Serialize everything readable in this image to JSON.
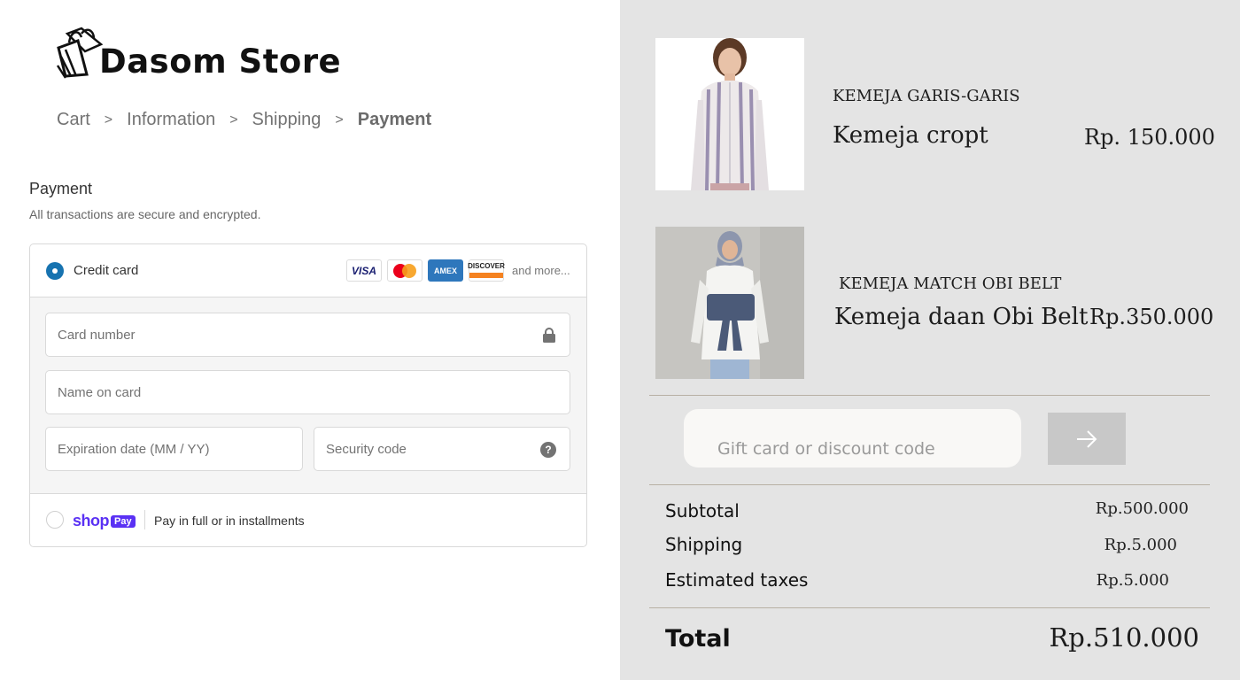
{
  "brand": {
    "name": "Dasom Store",
    "icon": "shopping-bags-icon"
  },
  "breadcrumb": [
    {
      "label": "Cart"
    },
    {
      "label": "Information"
    },
    {
      "label": "Shipping"
    },
    {
      "label": "Payment",
      "current": true
    }
  ],
  "breadcrumb_separator": ">",
  "payment": {
    "title": "Payment",
    "subtitle": "All transactions are secure and encrypted.",
    "credit_card": {
      "label": "Credit card",
      "selected": true,
      "brands": [
        "VISA",
        "Mastercard",
        "AMEX",
        "DISCOVER"
      ],
      "more": "and more...",
      "fields": {
        "card_number": "Card number",
        "name_on_card": "Name on card",
        "expiration": "Expiration date (MM / YY)",
        "security_code": "Security code"
      },
      "lock_icon": "lock-icon",
      "help_icon": "question-circle-icon",
      "help_glyph": "?"
    },
    "shop_pay": {
      "logo_word": "shop",
      "logo_badge": "Pay",
      "label": "Pay in full or in installments",
      "selected": false
    }
  },
  "colors": {
    "accent": "#1773b0",
    "shop_pay": "#5a31f4",
    "summary_bg": "#e4e4e4"
  },
  "products": [
    {
      "category": "KEMEJA GARIS-GARIS",
      "name": "Kemeja cropt",
      "price": "Rp. 150.000",
      "image": "striped-shirt-photo"
    },
    {
      "category": "KEMEJA MATCH OBI BELT",
      "name": "Kemeja daan Obi Belt",
      "price": "Rp.350.000",
      "image": "white-shirt-obi-belt-photo"
    }
  ],
  "discount": {
    "placeholder": "Gift card or discount code",
    "apply_icon": "arrow-right-icon"
  },
  "summary": {
    "subtotal_label": "Subtotal",
    "subtotal": "Rp.500.000",
    "shipping_label": "Shipping",
    "shipping": "Rp.5.000",
    "taxes_label": "Estimated taxes",
    "taxes": "Rp.5.000",
    "total_label": "Total",
    "total": "Rp.510.000"
  }
}
